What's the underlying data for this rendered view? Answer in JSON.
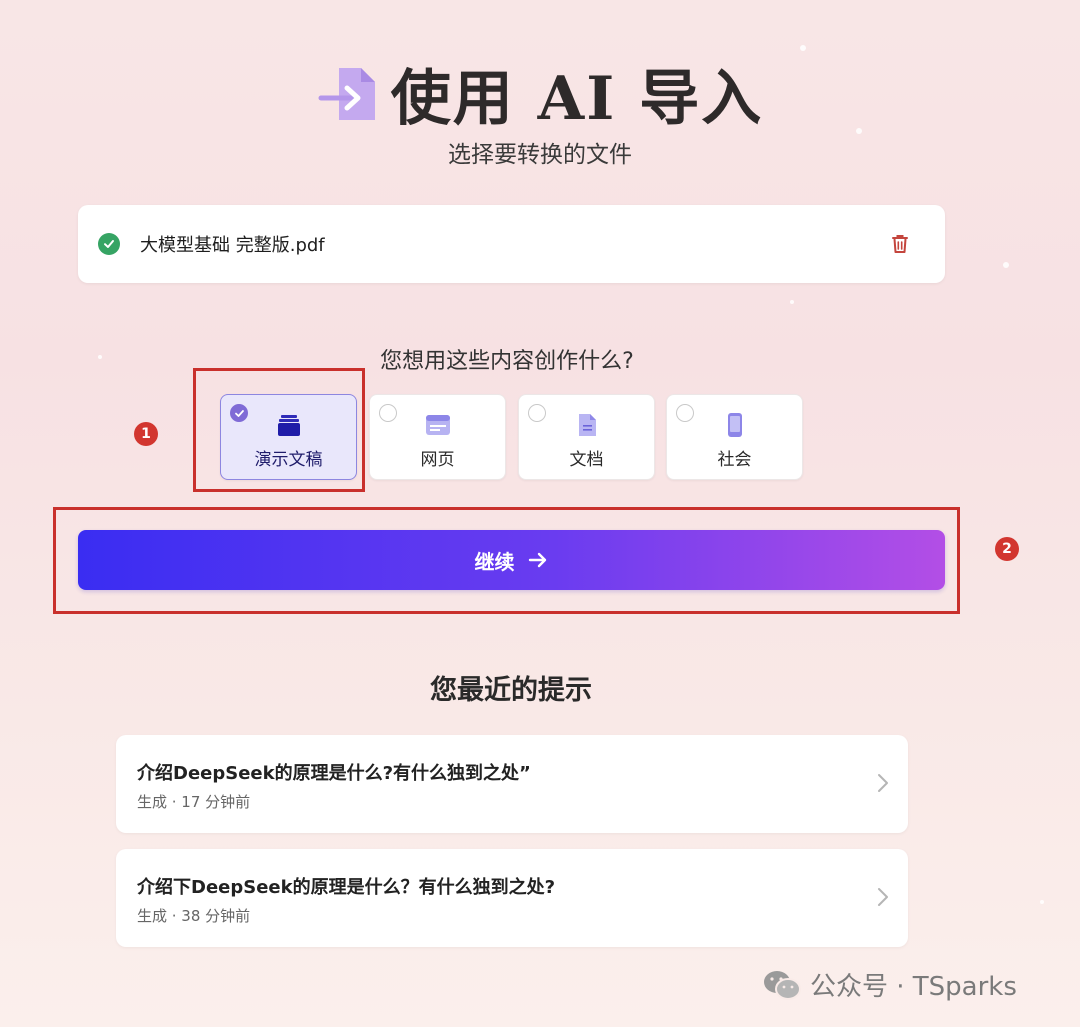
{
  "header": {
    "title": "使用 AI 导入",
    "subtitle": "选择要转换的文件",
    "icon": "file-import-icon"
  },
  "file": {
    "name": "大模型基础 完整版.pdf",
    "status_icon": "check-circle-icon",
    "delete_icon": "trash-icon"
  },
  "question": "您想用这些内容创作什么?",
  "options": [
    {
      "label": "演示文稿",
      "icon": "presentation-icon",
      "selected": true
    },
    {
      "label": "网页",
      "icon": "webpage-icon",
      "selected": false
    },
    {
      "label": "文档",
      "icon": "document-icon",
      "selected": false
    },
    {
      "label": "社会",
      "icon": "phone-icon",
      "selected": false
    }
  ],
  "markers": [
    "1",
    "2"
  ],
  "continue_label": "继续",
  "recent": {
    "title": "您最近的提示",
    "items": [
      {
        "title": "介绍DeepSeek的原理是什么?有什么独到之处”",
        "meta": "生成 · 17 分钟前"
      },
      {
        "title": "介绍下DeepSeek的原理是什么？有什么独到之处?",
        "meta": "生成 · 38 分钟前"
      }
    ]
  },
  "watermark": "公众号 · TSparks",
  "colors": {
    "accent_start": "#3a2df2",
    "accent_end": "#b34ee6",
    "annotation_red": "#c9302c",
    "success_green": "#36a464"
  }
}
